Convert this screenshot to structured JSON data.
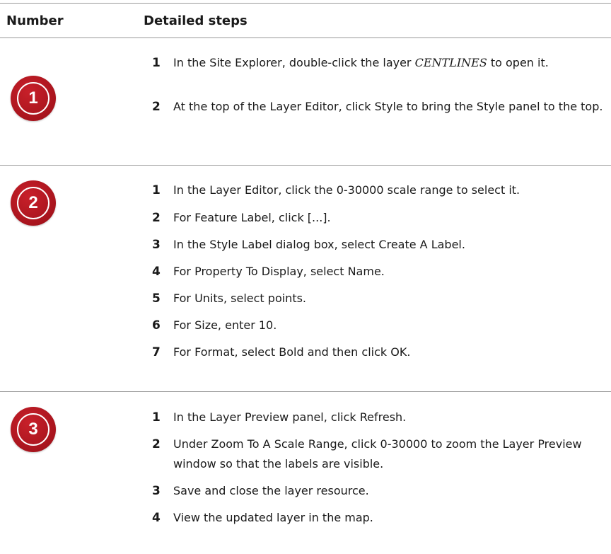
{
  "header": {
    "col_number": "Number",
    "col_steps": "Detailed steps"
  },
  "sections": [
    {
      "badge": "1",
      "steps": [
        {
          "num": "1",
          "text_before": "In the Site Explorer, double-click the layer ",
          "text_italic": "CENTLINES",
          "text_after": "  to open it."
        },
        {
          "num": "2",
          "text": "At the top of the Layer Editor, click Style to bring the Style panel to the top."
        }
      ]
    },
    {
      "badge": "2",
      "steps": [
        {
          "num": "1",
          "text": "In the Layer Editor, click the 0-30000 scale range to select it."
        },
        {
          "num": "2",
          "text": "For Feature Label, click [...]."
        },
        {
          "num": "3",
          "text": "In the Style Label dialog box, select Create A Label."
        },
        {
          "num": "4",
          "text": "For Property To Display, select Name."
        },
        {
          "num": "5",
          "text": "For Units, select points."
        },
        {
          "num": "6",
          "text": "For Size, enter 10."
        },
        {
          "num": "7",
          "text": "For Format, select Bold and then click OK."
        }
      ]
    },
    {
      "badge": "3",
      "steps": [
        {
          "num": "1",
          "text": "In the Layer Preview panel, click Refresh."
        },
        {
          "num": "2",
          "text": "Under Zoom To A Scale Range, click 0-30000 to zoom the Layer Preview window so that the labels are visible."
        },
        {
          "num": "3",
          "text": "Save and close the layer resource."
        },
        {
          "num": "4",
          "text": "View the updated layer in the map."
        }
      ]
    }
  ]
}
